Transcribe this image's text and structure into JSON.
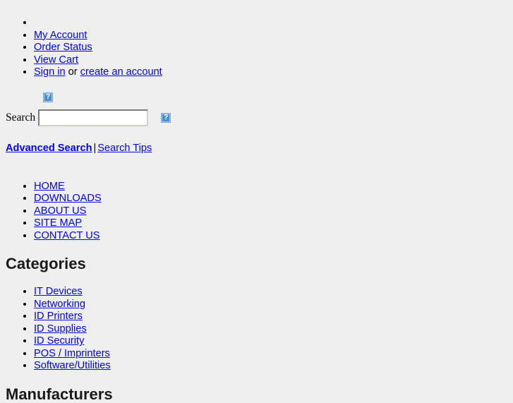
{
  "account_nav": {
    "items": [
      {
        "label": "",
        "empty": true
      },
      {
        "label": "My Account",
        "empty": false
      },
      {
        "label": "Order Status",
        "empty": false
      },
      {
        "label": "View Cart",
        "empty": false
      }
    ],
    "signin_label": "Sign in",
    "or_text": " or ",
    "create_account_label": "create an account"
  },
  "logo": {
    "icon": "broken-image-icon",
    "alt": "?"
  },
  "search": {
    "label": "Search",
    "value": "",
    "placeholder": "",
    "go_icon": "broken-image-icon",
    "advanced_label": "Advanced Search",
    "separator": "|",
    "tips_label": "Search Tips"
  },
  "main_nav": {
    "items": [
      {
        "label": "HOME"
      },
      {
        "label": "DOWNLOADS"
      },
      {
        "label": "ABOUT US"
      },
      {
        "label": "SITE MAP"
      },
      {
        "label": "CONTACT US"
      }
    ]
  },
  "categories": {
    "heading": "Categories",
    "items": [
      {
        "label": "IT Devices"
      },
      {
        "label": "Networking"
      },
      {
        "label": "ID Printers"
      },
      {
        "label": "ID Supplies"
      },
      {
        "label": "ID Security"
      },
      {
        "label": "POS / Imprinters"
      },
      {
        "label": "Software/Utilities"
      }
    ]
  },
  "manufacturers": {
    "heading": "Manufacturers"
  },
  "colors": {
    "background": "#efefef",
    "link": "#0000ee",
    "text": "#000000",
    "broken_image": "#4a8fd4"
  }
}
